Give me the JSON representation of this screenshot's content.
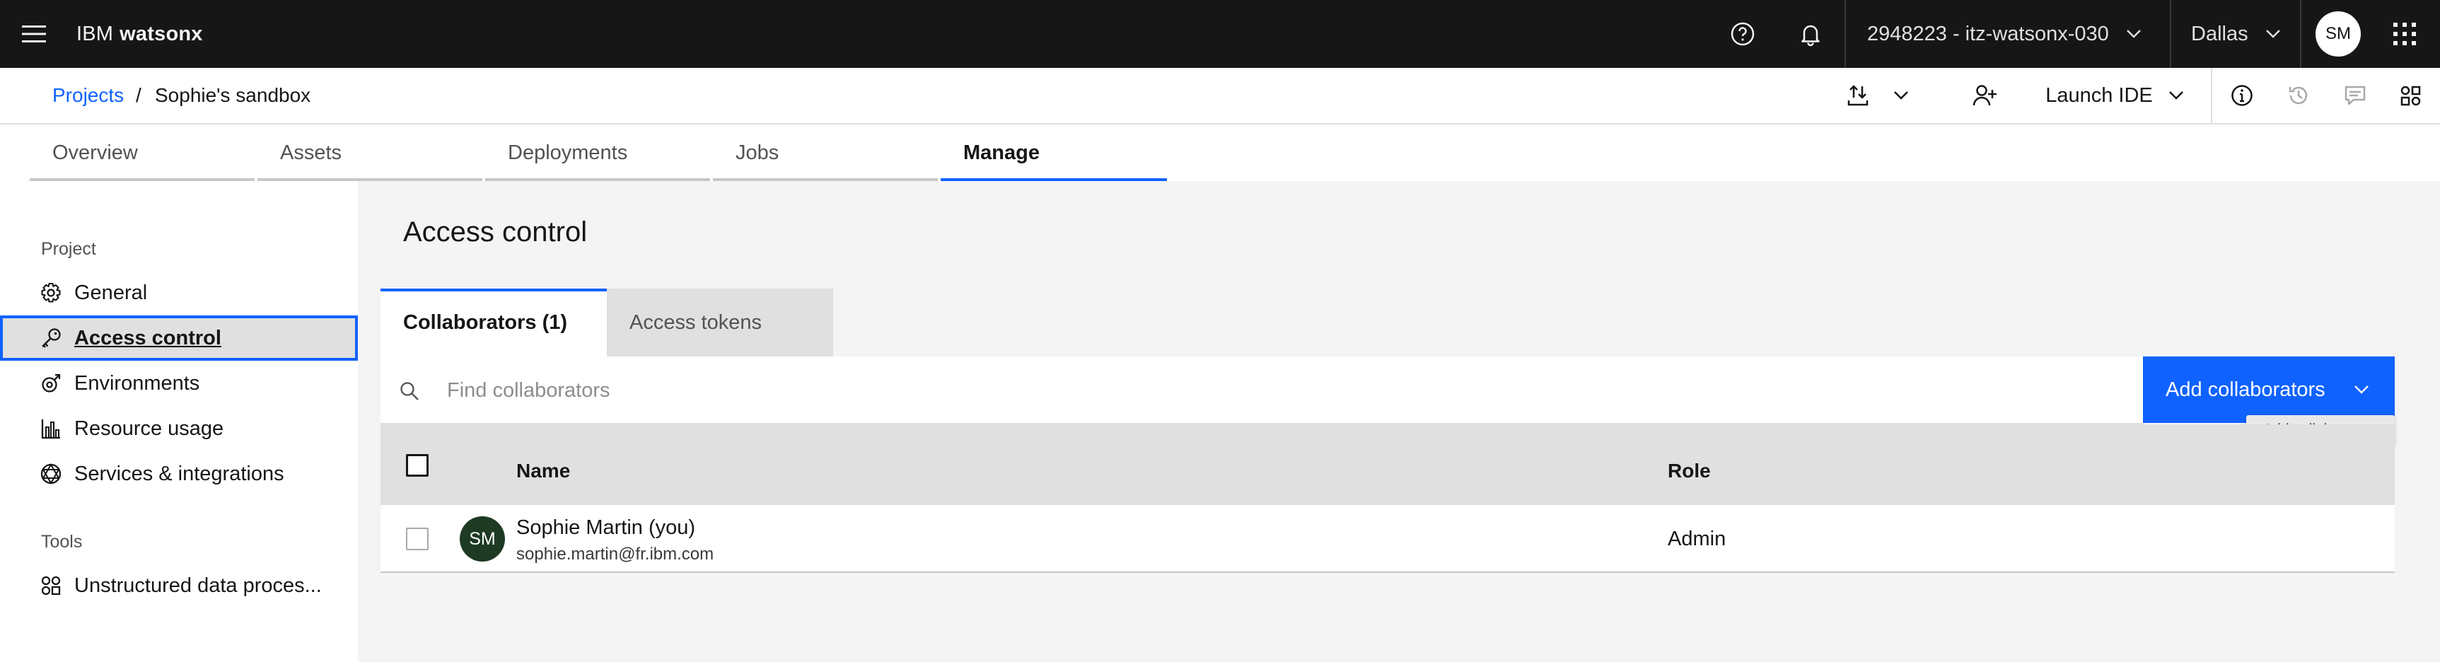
{
  "header": {
    "brand_prefix": "IBM",
    "brand_name": "watsonx",
    "account": "2948223 - itz-watsonx-030",
    "region": "Dallas",
    "avatar_initials": "SM",
    "icons": [
      "menu-icon",
      "help-icon",
      "notification-icon",
      "chevron-down-icon",
      "app-switcher-icon"
    ]
  },
  "breadcrumb": {
    "root": "Projects",
    "separator": "/",
    "current": "Sophie's sandbox"
  },
  "toolbar": {
    "launch_ide": "Launch IDE",
    "icons": [
      "import-export-icon",
      "chevron-down-icon",
      "add-user-icon",
      "information-icon",
      "history-icon",
      "comment-icon",
      "apps-icon"
    ]
  },
  "tabs": [
    {
      "label": "Overview"
    },
    {
      "label": "Assets"
    },
    {
      "label": "Deployments"
    },
    {
      "label": "Jobs"
    },
    {
      "label": "Manage",
      "active": true
    }
  ],
  "sidebar": {
    "sections": [
      {
        "heading": "Project",
        "items": [
          {
            "label": "General",
            "icon": "settings-icon"
          },
          {
            "label": "Access control",
            "icon": "key-icon",
            "active": true
          },
          {
            "label": "Environments",
            "icon": "environment-icon"
          },
          {
            "label": "Resource usage",
            "icon": "chart-bar-icon"
          },
          {
            "label": "Services & integrations",
            "icon": "integration-icon"
          }
        ]
      },
      {
        "heading": "Tools",
        "items": [
          {
            "label": "Unstructured data proces...",
            "icon": "data-tools-icon"
          }
        ]
      }
    ]
  },
  "main": {
    "title": "Access control",
    "subtabs": [
      {
        "label": "Collaborators (1)",
        "selected": true
      },
      {
        "label": "Access tokens",
        "selected": false
      }
    ],
    "search": {
      "placeholder": "Find collaborators",
      "value": ""
    },
    "add_button": "Add collaborators",
    "tooltip": "Add collaborators",
    "table": {
      "columns": [
        "Name",
        "Role"
      ],
      "rows": [
        {
          "initials": "SM",
          "name": "Sophie Martin (you)",
          "email": "sophie.martin@fr.ibm.com",
          "role": "Admin"
        }
      ]
    }
  },
  "colors": {
    "header_bg": "#161616",
    "accent": "#0f62fe",
    "page_bg": "#f4f4f4",
    "table_header_bg": "#e0e0e0",
    "avatar_green": "#1e3a23"
  }
}
